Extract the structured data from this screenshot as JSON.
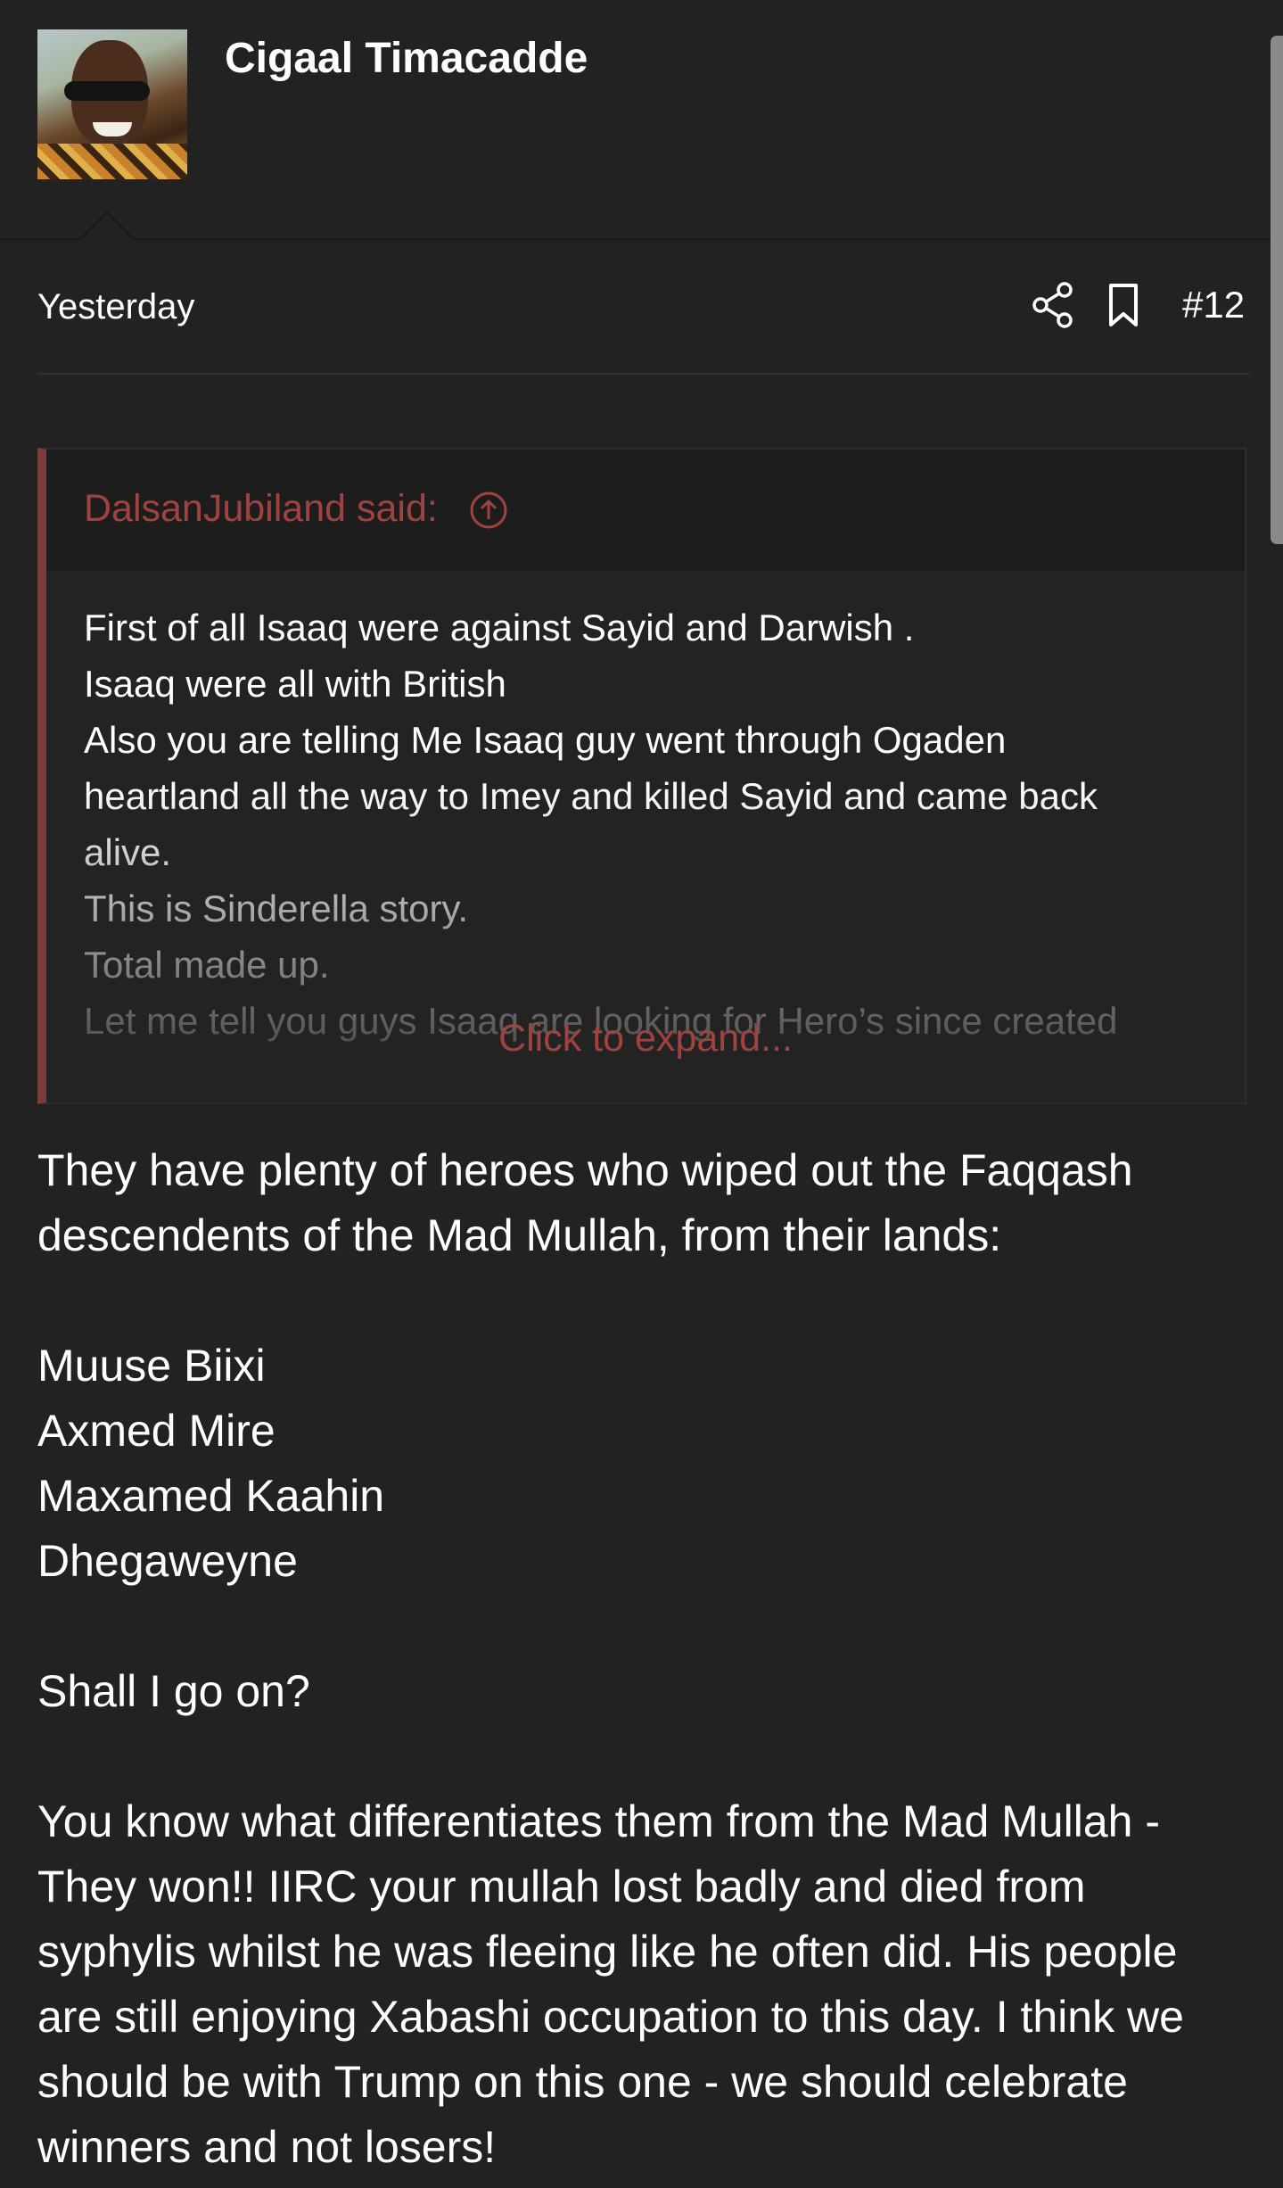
{
  "post": {
    "author": "Cigaal Timacadde",
    "date": "Yesterday",
    "number": "#12"
  },
  "quote": {
    "author": "DalsanJubiland said:",
    "lines": [
      "First of all Isaaq were against Sayid and Darwish .",
      "Isaaq were all with British",
      "Also you are telling Me Isaaq guy went through Ogaden",
      "heartland all the way to Imey and killed Sayid and came back",
      "alive.",
      "This is Sinderella story.",
      "Total made up.",
      "Let me tell you guys Isaaq are looking for Hero’s since created"
    ],
    "expand_label": "Click to expand..."
  },
  "body": {
    "intro_lines": [
      "They have plenty of heroes who wiped out the Faqqash",
      "descendents of the Mad Mullah, from their lands:"
    ],
    "heroes": [
      "Muuse Biixi",
      "Axmed Mire",
      "Maxamed Kaahin",
      "Dhegaweyne"
    ],
    "question": "Shall I go on?",
    "closing_lines": [
      "You know what differentiates them from the Mad Mullah -",
      "They won!! IIRC your mullah lost badly and died from",
      "syphylis whilst he was fleeing like he often did. His people",
      "are still enjoying Xabashi occupation to this day. I think we",
      "should be with Trump on this one - we should celebrate",
      "winners and not losers!"
    ]
  },
  "icons": {
    "share": "share-icon",
    "bookmark": "bookmark-icon",
    "quote_jump": "arrow-up-circle-icon"
  },
  "colors": {
    "background": "#222223",
    "quote_accent": "#a0433f",
    "quote_border": "#7d3b3b",
    "text": "#ffffff"
  }
}
